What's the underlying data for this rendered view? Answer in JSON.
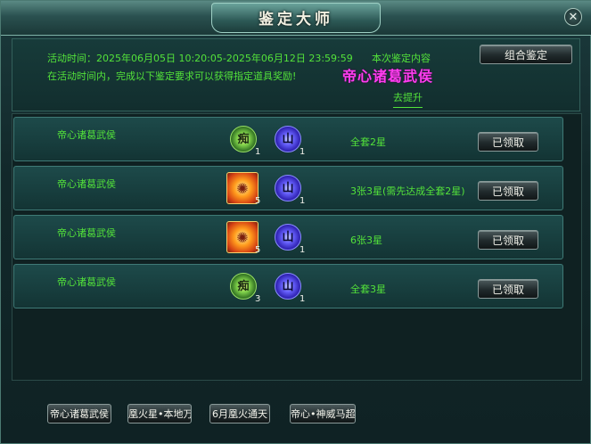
{
  "window": {
    "title": "鉴定大师",
    "close_glyph": "✕"
  },
  "info": {
    "time_line": "活动时间：2025年06月05日 10:20:05-2025年06月12日 23:59:59",
    "this_content": "本次鉴定内容",
    "desc_line": "在活动时间内，完成以下鉴定要求可以获得指定道具奖励!",
    "hero_name": "帝心诸葛武侯",
    "go_upgrade": "去提升"
  },
  "combo_button": "组合鉴定",
  "rows": [
    {
      "name": "帝心诸葛武侯",
      "icon1": "green-material-icon",
      "icon1_glyph": "痴",
      "icon1_count": "1",
      "icon2": "blue-spirit-icon",
      "icon2_glyph": "山",
      "icon2_count": "1",
      "condition": "全套2星",
      "button": "已领取"
    },
    {
      "name": "帝心诸葛武侯",
      "icon1": "gold-fire-icon",
      "icon1_glyph": "✺",
      "icon1_count": "5",
      "icon2": "blue-spirit-icon",
      "icon2_glyph": "山",
      "icon2_count": "1",
      "condition": "3张3星(需先达成全套2星)",
      "button": "已领取"
    },
    {
      "name": "帝心诸葛武侯",
      "icon1": "gold-fire-icon",
      "icon1_glyph": "✺",
      "icon1_count": "5",
      "icon2": "blue-spirit-icon",
      "icon2_glyph": "山",
      "icon2_count": "1",
      "condition": "6张3星",
      "button": "已领取"
    },
    {
      "name": "帝心诸葛武侯",
      "icon1": "green-material-icon",
      "icon1_glyph": "痴",
      "icon1_count": "3",
      "icon2": "blue-spirit-icon",
      "icon2_glyph": "山",
      "icon2_count": "1",
      "condition": "全套3星",
      "button": "已领取"
    }
  ],
  "bottom_tabs": [
    "帝心诸葛武侯",
    "凰火星•本地万",
    "6月凰火通天",
    "帝心•神威马超"
  ]
}
